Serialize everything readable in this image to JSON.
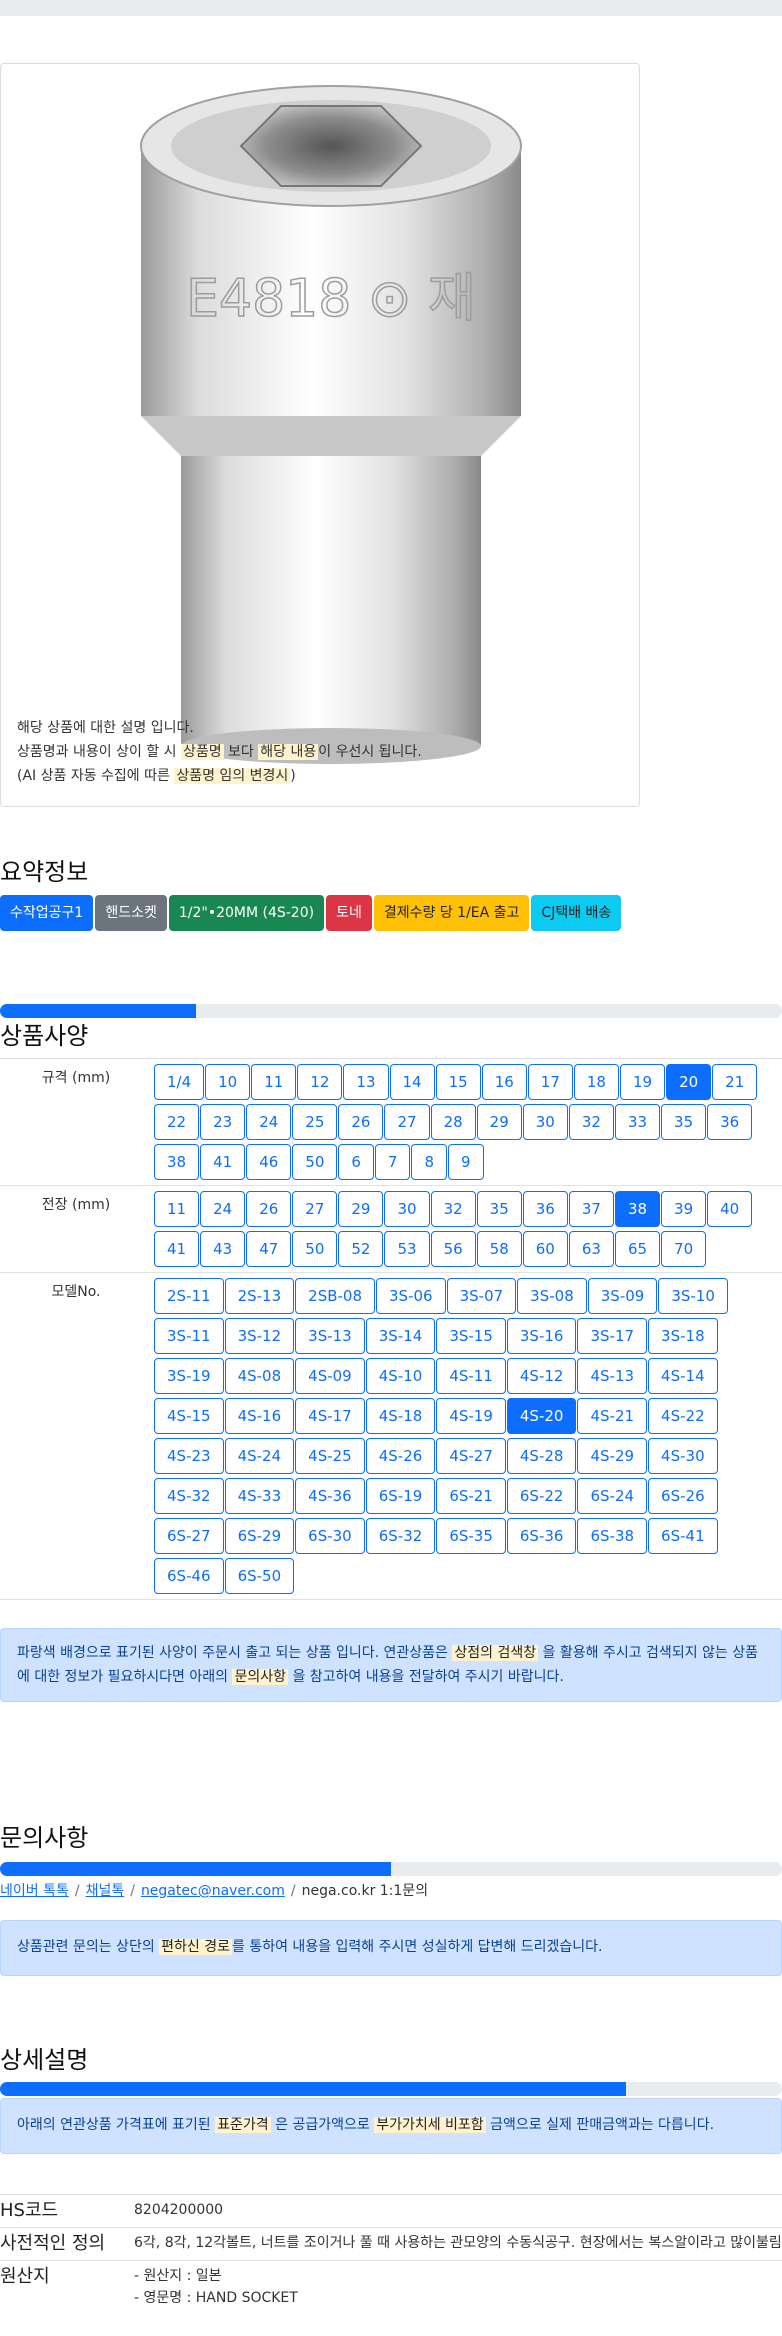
{
  "image_notice": {
    "line1": "해당 상품에 대한 설명 입니다.",
    "line2_a": "상품명과 내용이 상이 할 시",
    "line2_hl1": "상품명",
    "line2_b": "보다",
    "line2_hl2": "해당 내용",
    "line2_c": "이 우선시 됩니다.",
    "line3_a": "(AI 상품 자동 수집에 따른",
    "line3_hl": "상품명 임의 변경시",
    "line3_b": ")"
  },
  "product_engraving": "E4818 ⊙ 재",
  "summary": {
    "title": "요약정보",
    "badges": [
      {
        "label": "수작업공구1",
        "color": "#0d6efd"
      },
      {
        "label": "핸드소켓",
        "color": "#6c757d"
      },
      {
        "label": "1/2\"•20MM (4S-20)",
        "color": "#198754"
      },
      {
        "label": "토네",
        "color": "#dc3545"
      },
      {
        "label": "결제수량 당 1/EA 출고",
        "color": "#ffc107",
        "text_color": "#222222"
      },
      {
        "label": "CJ택배 배송",
        "color": "#0dcaf0",
        "text_color": "#222222"
      }
    ]
  },
  "spec": {
    "title": "상품사양",
    "progress": 0.25,
    "rows": [
      {
        "label": "규격 (mm)",
        "options": [
          "1/4",
          "10",
          "11",
          "12",
          "13",
          "14",
          "15",
          "16",
          "17",
          "18",
          "19",
          "20",
          "21",
          "22",
          "23",
          "24",
          "25",
          "26",
          "27",
          "28",
          "29",
          "30",
          "32",
          "33",
          "35",
          "36",
          "38",
          "41",
          "46",
          "50",
          "6",
          "7",
          "8",
          "9"
        ],
        "selected": "20"
      },
      {
        "label": "전장 (mm)",
        "options": [
          "11",
          "24",
          "26",
          "27",
          "29",
          "30",
          "32",
          "35",
          "36",
          "37",
          "38",
          "39",
          "40",
          "41",
          "43",
          "47",
          "50",
          "52",
          "53",
          "56",
          "58",
          "60",
          "63",
          "65",
          "70"
        ],
        "selected": "38"
      },
      {
        "label": "모델No.",
        "options": [
          "2S-11",
          "2S-13",
          "2SB-08",
          "3S-06",
          "3S-07",
          "3S-08",
          "3S-09",
          "3S-10",
          "3S-11",
          "3S-12",
          "3S-13",
          "3S-14",
          "3S-15",
          "3S-16",
          "3S-17",
          "3S-18",
          "3S-19",
          "4S-08",
          "4S-09",
          "4S-10",
          "4S-11",
          "4S-12",
          "4S-13",
          "4S-14",
          "4S-15",
          "4S-16",
          "4S-17",
          "4S-18",
          "4S-19",
          "4S-20",
          "4S-21",
          "4S-22",
          "4S-23",
          "4S-24",
          "4S-25",
          "4S-26",
          "4S-27",
          "4S-28",
          "4S-29",
          "4S-30",
          "4S-32",
          "4S-33",
          "4S-36",
          "6S-19",
          "6S-21",
          "6S-22",
          "6S-24",
          "6S-26",
          "6S-27",
          "6S-29",
          "6S-30",
          "6S-32",
          "6S-35",
          "6S-36",
          "6S-38",
          "6S-41",
          "6S-46",
          "6S-50"
        ],
        "selected": "4S-20"
      }
    ],
    "alert_a": "파랑색 배경으로 표기된 사양이 주문시 출고 되는 상품 입니다. 연관상품은",
    "alert_hl1": "상점의 검색창",
    "alert_b": "을 활용해 주시고 검색되지 않는 상품에 대한 정보가 필요하시다면 아래의",
    "alert_hl2": "문의사항",
    "alert_c": "을 참고하여 내용을 전달하여 주시기 바랍니다."
  },
  "inquiry": {
    "title": "문의사항",
    "progress": 0.5,
    "links": [
      "네이버 톡톡",
      "채널톡",
      "negatec@naver.com"
    ],
    "plain": "nega.co.kr 1:1문의",
    "alert_a": "상품관련 문의는 상단의",
    "alert_hl": "편하신 경로",
    "alert_b": "를 통하여 내용을 입력해 주시면 성실하게 답변해 드리겠습니다."
  },
  "detail": {
    "title": "상세설명",
    "progress": 0.8,
    "alert_a": "아래의 연관상품 가격표에 표기된",
    "alert_hl1": "표준가격",
    "alert_b": "은 공급가액으로",
    "alert_hl2": "부가가치세 비포함",
    "alert_c": "금액으로 실제 판매금액과는 다릅니다.",
    "info": [
      {
        "key": "HS코드",
        "value": "8204200000"
      },
      {
        "key": "사전적인 정의",
        "value": "6각, 8각, 12각볼트, 너트를 조이거나 풀 때 사용하는 관모양의 수동식공구. 현장에서는 복스알이라고 많이불림"
      },
      {
        "key": "원산지",
        "lines": [
          "- 원산지 : 일본",
          "- 영문명 : HAND SOCKET"
        ]
      }
    ]
  }
}
